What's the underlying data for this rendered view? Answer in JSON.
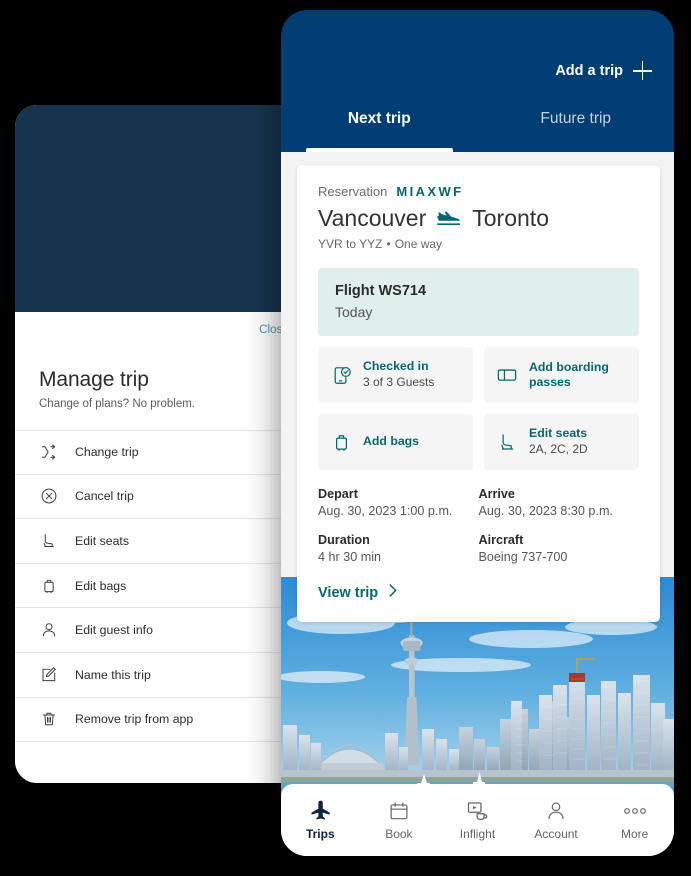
{
  "colors": {
    "navy": "#003D72",
    "panel_navy": "#17344F",
    "teal": "#056670",
    "mint": "#E1EFEC",
    "tile_grey": "#f5f5f5",
    "close_teal": "#4a9aa5",
    "nav_active": "#0c2340",
    "page_background": "#000000"
  },
  "back_panel": {
    "close_label": "Close",
    "title": "Manage trip",
    "subtitle": "Change of plans? No problem.",
    "items": [
      {
        "label": "Change trip",
        "icon": "shuffle-icon"
      },
      {
        "label": "Cancel trip",
        "icon": "cancel-circle-icon"
      },
      {
        "label": "Edit seats",
        "icon": "seat-icon"
      },
      {
        "label": "Edit bags",
        "icon": "bag-icon"
      },
      {
        "label": "Edit guest info",
        "icon": "person-icon"
      },
      {
        "label": "Name this trip",
        "icon": "pencil-square-icon"
      },
      {
        "label": "Remove trip from app",
        "icon": "trash-icon"
      }
    ]
  },
  "phone": {
    "header": {
      "add_trip_label": "Add a trip",
      "add_trip_icon": "plus-icon"
    },
    "tabs": [
      {
        "label": "Next trip",
        "active": true
      },
      {
        "label": "Future trip",
        "active": false
      }
    ],
    "reservation": {
      "reservation_label": "Reservation",
      "reservation_code": "MIAXWF",
      "origin_city": "Vancouver",
      "destination_city": "Toronto",
      "plane_icon": "airplane-landing-icon",
      "route_airports": "YVR to YYZ",
      "route_separator": "•",
      "route_type": "One way",
      "flight": {
        "number": "Flight WS714",
        "when": "Today"
      },
      "tiles": [
        {
          "icon": "phone-check-icon",
          "title": "Checked in",
          "sub": "3 of 3 Guests"
        },
        {
          "icon": "boarding-pass-icon",
          "title": "Add boarding passes",
          "sub": ""
        },
        {
          "icon": "bag-icon",
          "title": "Add bags",
          "sub": ""
        },
        {
          "icon": "seat-icon",
          "title": "Edit seats",
          "sub": "2A, 2C, 2D"
        }
      ],
      "details": [
        {
          "label": "Depart",
          "value": "Aug. 30, 2023 1:00 p.m."
        },
        {
          "label": "Arrive",
          "value": "Aug. 30, 2023 8:30 p.m."
        },
        {
          "label": "Duration",
          "value": "4 hr 30 min"
        },
        {
          "label": "Aircraft",
          "value": "Boeing 737-700"
        }
      ],
      "view_trip_label": "View trip",
      "view_trip_icon": "chevron-right-icon"
    },
    "skyline_alt": "Toronto skyline with CN Tower over Lake Ontario",
    "bottom_nav": [
      {
        "label": "Trips",
        "icon": "airplane-icon",
        "active": true
      },
      {
        "label": "Book",
        "icon": "calendar-icon",
        "active": false
      },
      {
        "label": "Inflight",
        "icon": "inflight-entertainment-icon",
        "active": false
      },
      {
        "label": "Account",
        "icon": "person-icon",
        "active": false
      },
      {
        "label": "More",
        "icon": "ellipsis-icon",
        "active": false
      }
    ]
  }
}
